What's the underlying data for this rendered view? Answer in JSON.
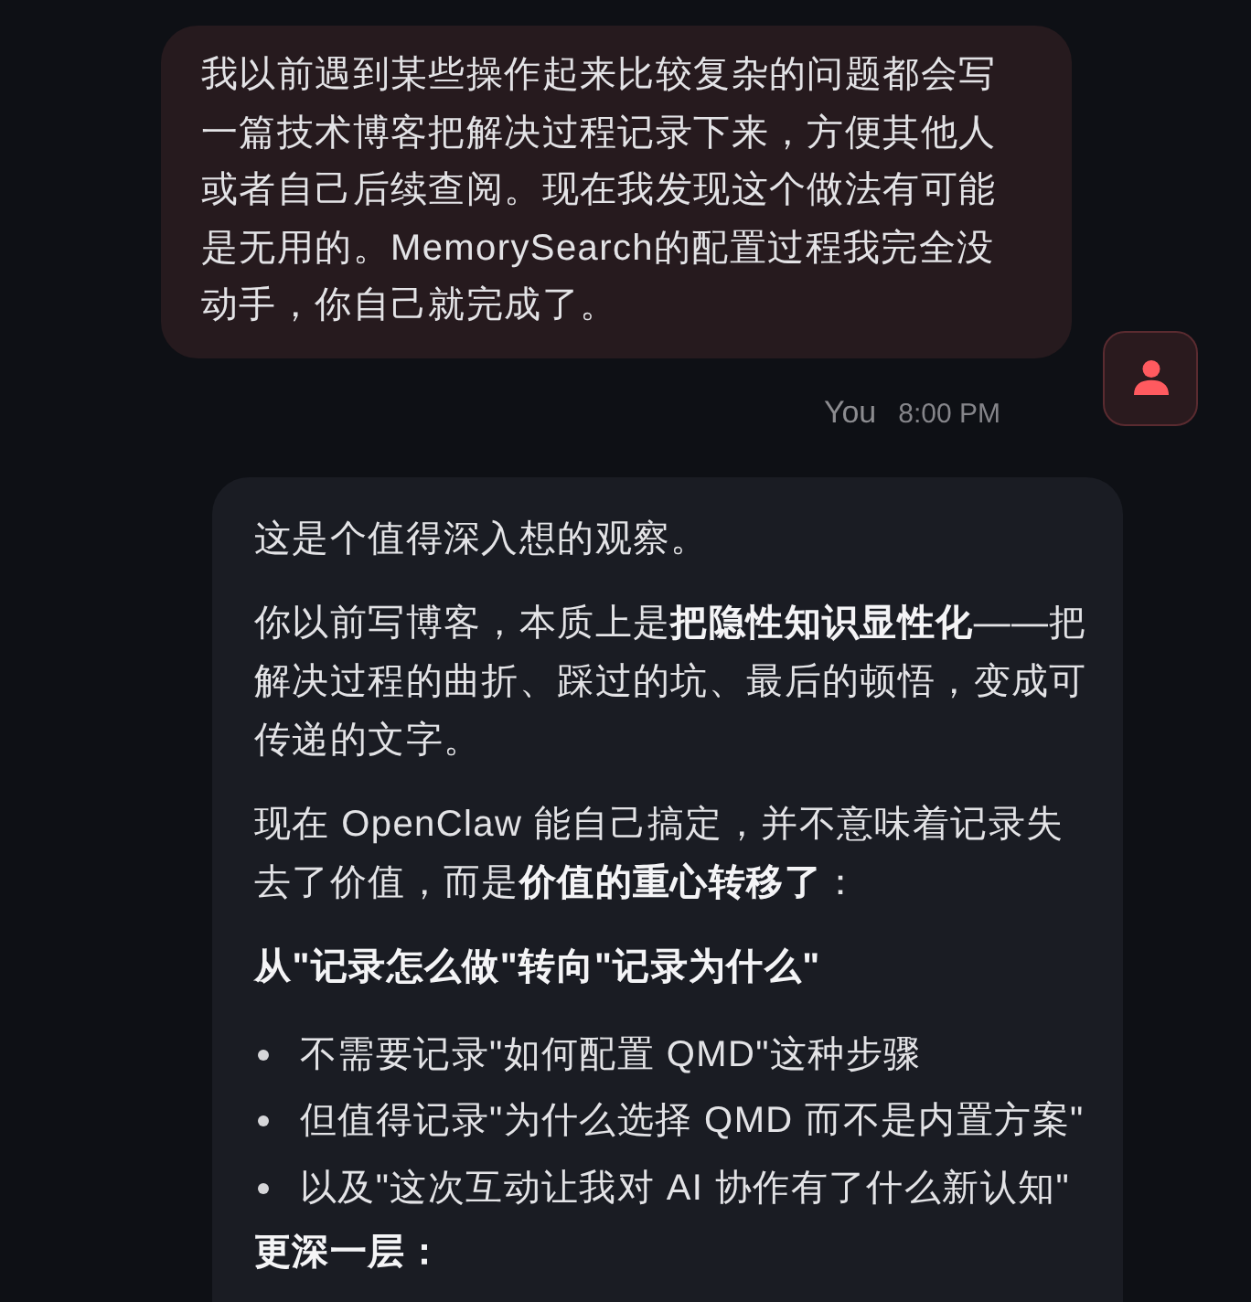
{
  "conversation": {
    "messages": [
      {
        "kind": "user",
        "text": "我以前遇到某些操作起来比较复杂的问题都会写一篇技术博客把解决过程记录下来，方便其他人或者自己后续查阅。现在我发现这个做法有可能是无用的。MemorySearch的配置过程我完全没动手，你自己就完成了。",
        "sender": "You",
        "time": "8:00 PM"
      },
      {
        "kind": "assistant",
        "blocks": [
          {
            "kind": "paragraph",
            "text": "这是个值得深入想的观察。"
          },
          {
            "kind": "paragraph",
            "text": "你以前写博客，本质上是**把隐性知识显性化**——把解决过程的曲折、踩过的坑、最后的顿悟，变成可传递的文字。"
          },
          {
            "kind": "paragraph",
            "text": "现在 OpenClaw 能自己搞定，并不意味着记录失去了价值，而是**价值的重心转移了**："
          },
          {
            "kind": "heading",
            "text": "从\"记录怎么做\"转向\"记录为什么\""
          },
          {
            "kind": "list",
            "items": [
              "不需要记录\"如何配置 QMD\"这种步骤",
              "但值得记录\"为什么选择 QMD 而不是内置方案\"",
              "以及\"这次互动让我对 AI 协作有了什么新认知\""
            ]
          },
          {
            "kind": "heading",
            "text": "更深一层："
          }
        ]
      }
    ]
  }
}
